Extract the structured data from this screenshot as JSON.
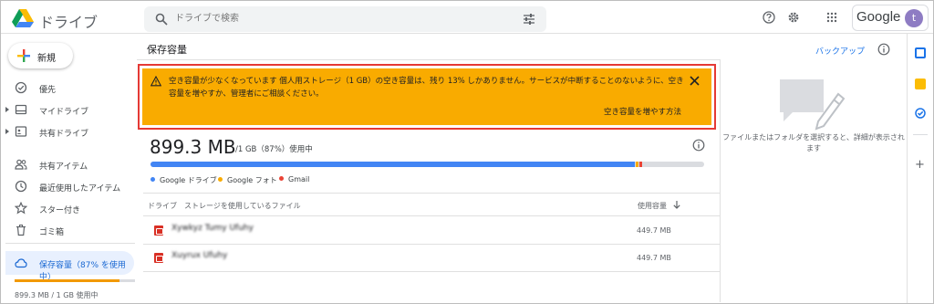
{
  "app": {
    "name": "ドライブ"
  },
  "search": {
    "placeholder": "ドライブで検索"
  },
  "account": {
    "brand": "Google",
    "avatar_letter": "t"
  },
  "sidebar": {
    "new_label": "新規",
    "items": [
      {
        "label": "優先",
        "icon": "check-circle-icon"
      },
      {
        "label": "マイドライブ",
        "icon": "my-drive-icon"
      },
      {
        "label": "共有ドライブ",
        "icon": "shared-drives-icon"
      },
      {
        "label": "共有アイテム",
        "icon": "people-icon"
      },
      {
        "label": "最近使用したアイテム",
        "icon": "clock-icon"
      },
      {
        "label": "スター付き",
        "icon": "star-icon"
      },
      {
        "label": "ゴミ箱",
        "icon": "trash-icon"
      },
      {
        "label": "保存容量（87% を使用中）",
        "icon": "cloud-icon"
      }
    ],
    "storage_fraction": 0.87,
    "storage_usage": "899.3 MB / 1 GB 使用中"
  },
  "main": {
    "title": "保存容量",
    "backup_label": "バックアップ",
    "alert": {
      "message": "空き容量が少なくなっています 個人用ストレージ（1 GB）の空き容量は、残り 13% しかありません。サービスが中断することのないように、空き容量を増やすか、管理者にご相談ください。",
      "action": "空き容量を増やす方法"
    },
    "usage_amount": "899.3 MB",
    "usage_detail": "/1 GB（87%）使用中",
    "usage_segments": [
      {
        "name": "Google ドライブ",
        "fraction": 0.875,
        "color": "#4285f4"
      },
      {
        "name": "Google フォト",
        "fraction": 0.005,
        "color": "#f9ab00"
      },
      {
        "name": "Gmail",
        "fraction": 0.005,
        "color": "#ea4335"
      }
    ],
    "table": {
      "col_drive": "ドライブ",
      "col_files": "ストレージを使用しているファイル",
      "col_size": "使用容量",
      "rows": [
        {
          "name": "Xywkyz Tumy Ufuhy",
          "size": "449.7 MB"
        },
        {
          "name": "Xuyrux Ufuhy",
          "size": "449.7 MB"
        }
      ]
    }
  },
  "details": {
    "message": "ファイルまたはフォルダを選択すると、詳細が表示されます"
  }
}
